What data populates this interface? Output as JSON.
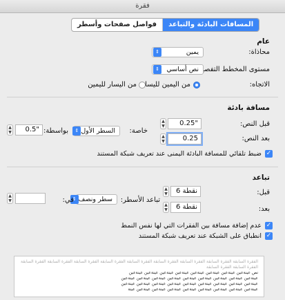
{
  "window": {
    "title": "فقرة"
  },
  "tabs": [
    {
      "label": "المسافات البادئة والتباعد"
    },
    {
      "label": "فواصل صفحات وأسطر"
    }
  ],
  "general": {
    "heading": "عام",
    "alignment_label": "محاذاة:",
    "alignment_value": "يمين",
    "outline_label": "مستوى المخطط التفصيلي:",
    "outline_value": "نص أساسي",
    "direction_label": "الاتجاه:",
    "rtl_option": "من اليمين لليسار",
    "ltr_option": "من اليسار لليمين"
  },
  "indentation": {
    "heading": "مسافة بادئة",
    "before_label": "قبل النص:",
    "before_value": "0.25\"",
    "after_label": "بعد النص:",
    "after_value": "0.25",
    "special_label": "خاصة:",
    "special_value": "السطر الأول",
    "by_label": "بواسطة:",
    "by_value": "0.5\"",
    "auto_adjust_label": "ضبط تلقائي للمسافة البادئة اليمنى عند تعريف شبكة المستند"
  },
  "spacing": {
    "heading": "تباعد",
    "before_label": "قبل:",
    "before_value": "6 نقطة",
    "after_label": "بعد:",
    "after_value": "6 نقطة",
    "line_label": "تباعد الأسطر:",
    "line_value": "سطر ونصف",
    "at_label": "في:",
    "at_value": "",
    "no_space_label": "عدم إضافة مسافة بين الفقرات التي لها نفس النمط",
    "snap_grid_label": "انطباق على الشبكة عند تعريف شبكة المستند"
  },
  "preview": {
    "prev_text": "الفقرة السابقة الفقرة السابقة الفقرة السابقة الفقرة السابقة الفقرة السابقة الفقرة السابقة الفقرة السابقة الفقرة السابقة الفقرة السابقة الفقرة السابقة الفقرة السابقة",
    "sample_lines": [
      "نص عينةعين عينةعين عينةعين عينةعين عينةعين عينةعين عينةعين عينةعين",
      "عينةعين عينةعين عينةعين عينةعين عينةعين عينةعين عينةعين عينةعين عينةعين",
      "عينةعين عينةعين عينةعين عينةعين عينةعين عينةعين عينةعين عينةعين عينةعين",
      "عينةعين عينةعين عينةعين عينةعين عينةعين عينةعين عينةعين عينةعين عينة"
    ]
  },
  "colors": {
    "accent": "#3c86f7"
  }
}
